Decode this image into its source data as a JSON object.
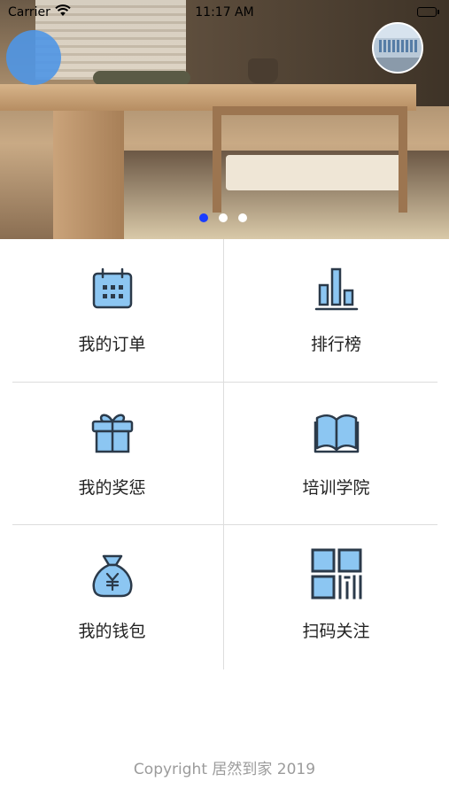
{
  "status_bar": {
    "carrier": "Carrier",
    "time": "11:17 AM"
  },
  "banner": {
    "slide_count": 3,
    "active_slide": 1
  },
  "menu": [
    {
      "label": "我的订单",
      "icon": "calendar-icon"
    },
    {
      "label": "排行榜",
      "icon": "bar-chart-icon"
    },
    {
      "label": "我的奖惩",
      "icon": "gift-icon"
    },
    {
      "label": "培训学院",
      "icon": "book-icon"
    },
    {
      "label": "我的钱包",
      "icon": "money-bag-icon"
    },
    {
      "label": "扫码关注",
      "icon": "qr-code-icon"
    }
  ],
  "footer": {
    "copyright": "Copyright 居然到家 2019"
  },
  "colors": {
    "icon_fill": "#8cc6f2",
    "icon_stroke": "#2b3a4a",
    "active_dot": "#1a3dff",
    "avatar": "#4f96e6"
  }
}
